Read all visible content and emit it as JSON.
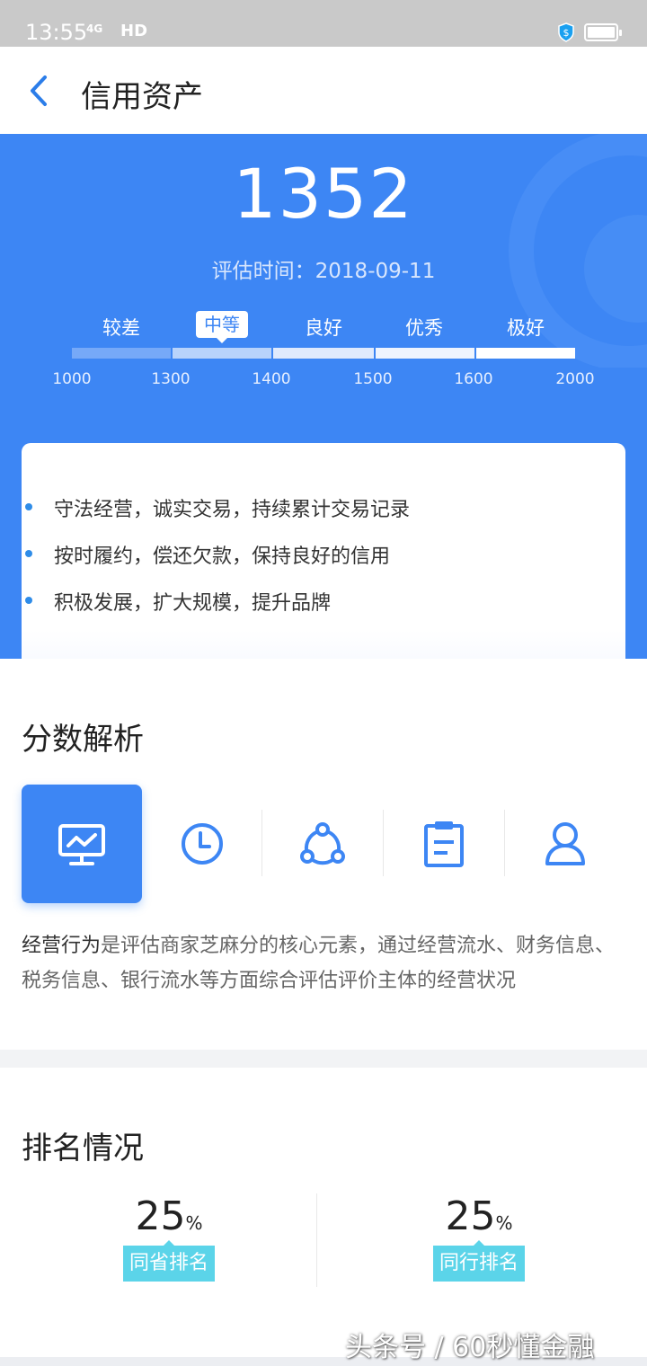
{
  "status_bar": {
    "time": "13:55",
    "signal": "4G",
    "network": "HD"
  },
  "nav": {
    "title": "信用资产",
    "back_label": "返回"
  },
  "score": {
    "value": "1352",
    "eval_label": "评估时间：",
    "eval_date": "2018-09-11",
    "levels": [
      "较差",
      "中等",
      "良好",
      "优秀",
      "极好"
    ],
    "active_level": "中等",
    "ticks": [
      "1000",
      "1300",
      "1400",
      "1500",
      "1600",
      "2000"
    ],
    "accent": "#3d86f4"
  },
  "tips": [
    "守法经营，诚实交易，持续累计交易记录",
    "按时履约，偿还欠款，保持良好的信用",
    "积极发展，扩大规模，提升品牌"
  ],
  "analysis": {
    "title": "分数解析",
    "tabs": [
      {
        "icon": "presentation-chart-icon",
        "active": true
      },
      {
        "icon": "clock-icon",
        "active": false
      },
      {
        "icon": "network-share-icon",
        "active": false
      },
      {
        "icon": "clipboard-icon",
        "active": false
      },
      {
        "icon": "person-icon",
        "active": false
      }
    ],
    "desc_highlight": "经营行为",
    "desc_text": "是评估商家芝麻分的核心元素，通过经营流水、财务信息、税务信息、银行流水等方面综合评估评价主体的经营状况"
  },
  "ranking": {
    "title": "排名情况",
    "items": [
      {
        "value": "25",
        "unit": "%",
        "label": "同省排名"
      },
      {
        "value": "25",
        "unit": "%",
        "label": "同行排名"
      }
    ],
    "badge_color": "#5bd4e9"
  },
  "watermark": "头条号 / 60秒懂金融"
}
